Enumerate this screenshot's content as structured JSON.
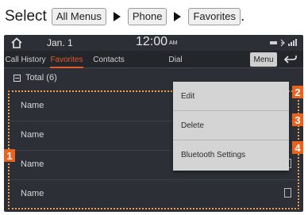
{
  "instruction": {
    "lead": "Select",
    "steps": [
      "All Menus",
      "Phone",
      "Favorites"
    ],
    "end": "."
  },
  "status": {
    "date": "Jan.  1",
    "time": "12:00",
    "ampm": "AM"
  },
  "tabs": [
    {
      "label": "Call History",
      "active": false
    },
    {
      "label": "Favorites",
      "active": true
    },
    {
      "label": "Contacts",
      "active": false
    },
    {
      "label": "Dial",
      "active": false
    }
  ],
  "menu_label": "Menu",
  "total_label": "Total (6)",
  "favorites": [
    {
      "name": "Name"
    },
    {
      "name": "Name"
    },
    {
      "name": "Name"
    },
    {
      "name": "Name"
    }
  ],
  "dropdown": [
    "Edit",
    "Delete",
    "Bluetooth Settings"
  ],
  "callouts": [
    "1",
    "2",
    "3",
    "4"
  ],
  "colors": {
    "accent": "#e35a2c",
    "callout": "#e8631f",
    "screen_bg": "#2c3036",
    "menu_bg": "#d4d4d4"
  }
}
